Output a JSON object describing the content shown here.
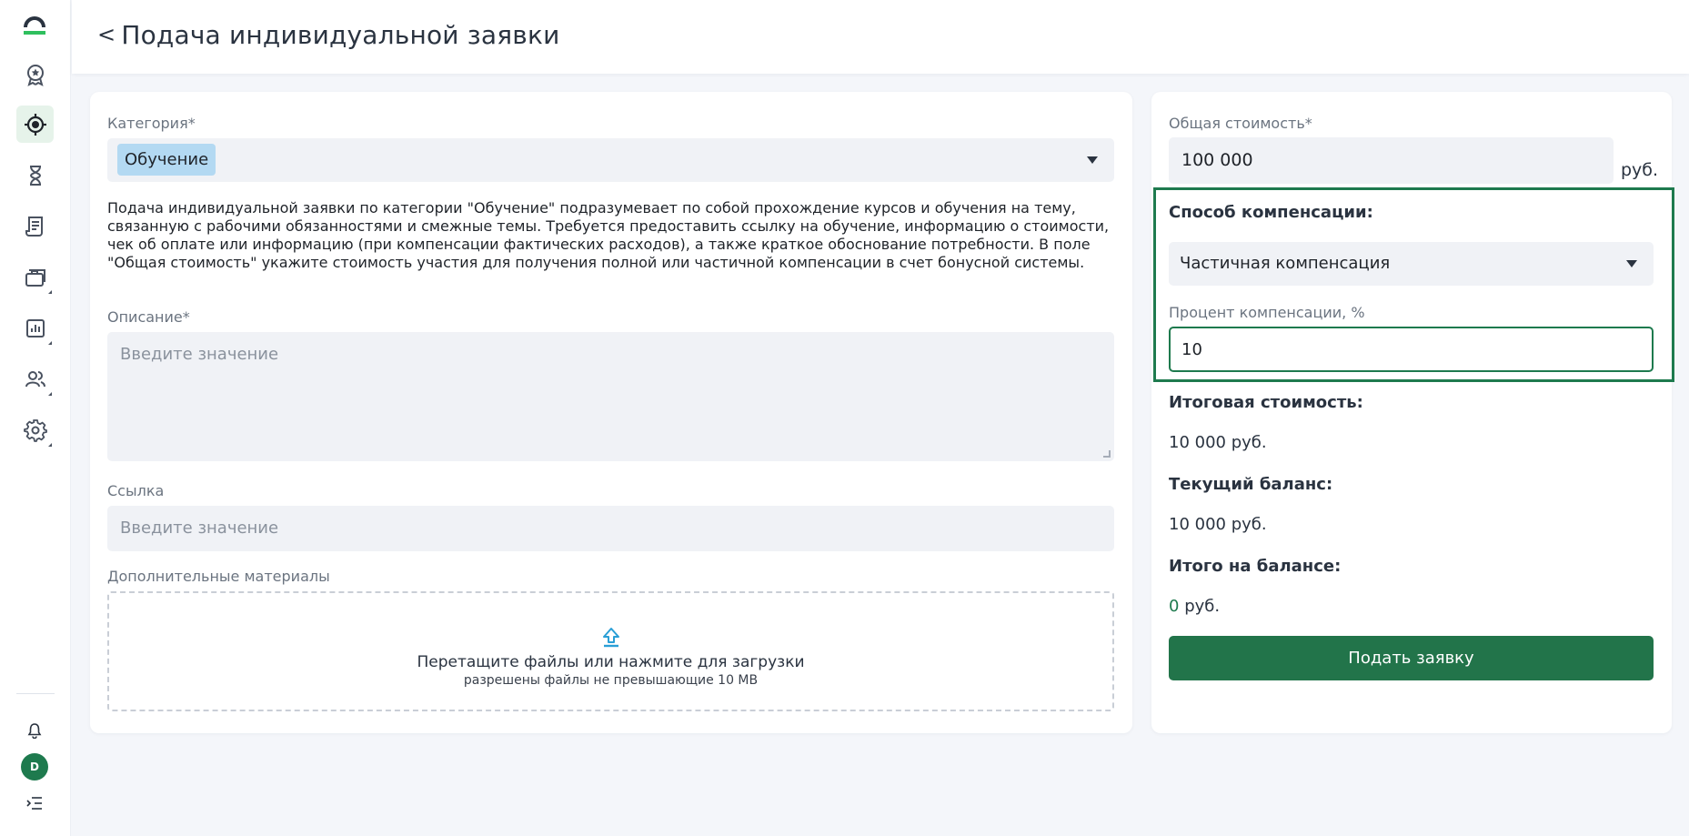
{
  "header": {
    "back_symbol": "<",
    "title": "Подача индивидуальной заявки"
  },
  "sidebar": {
    "items": [
      {
        "name": "award-icon",
        "active": false
      },
      {
        "name": "target-icon",
        "active": true
      },
      {
        "name": "hourglass-icon",
        "active": false
      },
      {
        "name": "receipt-icon",
        "active": false
      },
      {
        "name": "briefcase-icon",
        "active": false
      },
      {
        "name": "chart-icon",
        "active": false
      },
      {
        "name": "users-icon",
        "active": false
      },
      {
        "name": "gear-icon",
        "active": false
      }
    ],
    "avatar_letter": "D"
  },
  "form": {
    "category_label": "Категория*",
    "category_value": "Обучение",
    "category_description": "Подача индивидуальной заявки по категории \"Обучение\" подразумевает по собой прохождение курсов и обучения на тему, связанную с рабочими обязанностями и смежные темы. Требуется предоставить ссылку на обучение, информацию о стоимости, чек об оплате или информацию (при компенсации фактических расходов), а также краткое обоснование потребности. В поле \"Общая стоимость\" укажите стоимость участия для получения полной или частичной компенсации в счет бонусной системы.",
    "description_label": "Описание*",
    "description_placeholder": "Введите значение",
    "link_label": "Ссылка",
    "link_placeholder": "Введите значение",
    "materials_label": "Дополнительные материалы",
    "upload_main": "Перетащите файлы или нажмите для загрузки",
    "upload_sub": "разрешены файлы не превышающие 10 MB"
  },
  "summary": {
    "total_cost_label": "Общая стоимость*",
    "total_cost_value": "100 000",
    "currency": "руб.",
    "compensation_method_label": "Способ компенсации:",
    "compensation_method_value": "Частичная компенсация",
    "compensation_percent_label": "Процент компенсации, %",
    "compensation_percent_value": "10",
    "final_cost_label": "Итоговая стоимость:",
    "final_cost_value": "10 000 руб.",
    "current_balance_label": "Текущий баланс:",
    "current_balance_value": "10 000 руб.",
    "balance_total_label": "Итого на балансе:",
    "balance_total_number": "0",
    "balance_total_unit": "руб.",
    "submit_label": "Подать заявку"
  },
  "colors": {
    "accent": "#1e7a4e",
    "button": "#22744a",
    "chip": "#b3d9f2",
    "field_bg": "#f0f2f6"
  }
}
